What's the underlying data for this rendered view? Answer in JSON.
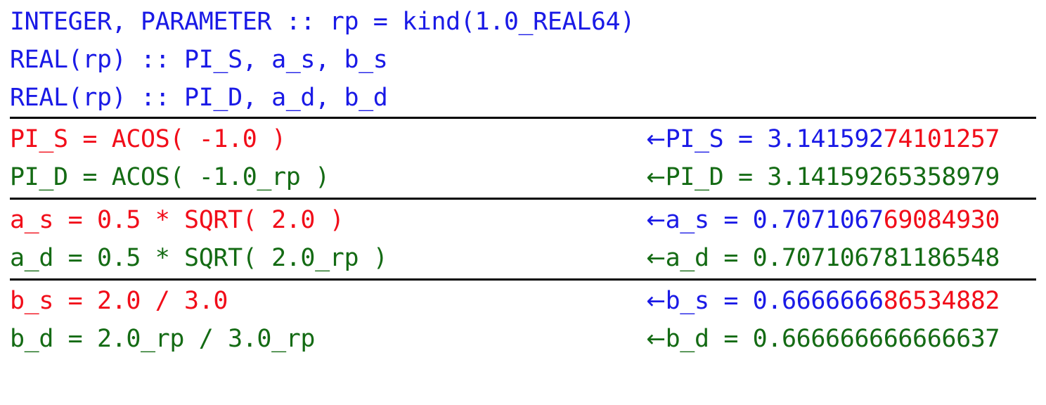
{
  "colors": {
    "single_precision": "#f10d19",
    "double_precision": "#146b14",
    "neutral": "#1a1ae6",
    "rule": "#000000",
    "background": "#ffffff"
  },
  "declarations": [
    {
      "text": "INTEGER, PARAMETER :: rp = kind(1.0_REAL64)",
      "color": "blue"
    },
    {
      "text": "REAL(rp) :: PI_S, a_s, b_s",
      "color": "blue"
    },
    {
      "text": "REAL(rp) :: PI_D, a_d, b_d",
      "color": "blue"
    }
  ],
  "arrow_glyph": "←",
  "groups": [
    {
      "single": {
        "statement": "PI_S = ACOS( -1.0 )",
        "result_label": "PI_S = ",
        "result_exact": "3.141592",
        "result_error": "74101257"
      },
      "double": {
        "statement": "PI_D = ACOS( -1.0_rp )",
        "result_label": "PI_D = ",
        "result_value": "3.14159265358979"
      }
    },
    {
      "single": {
        "statement": "a_s = 0.5 * SQRT( 2.0 )",
        "result_label": "a_s = ",
        "result_exact": "0.7071067",
        "result_error": "69084930"
      },
      "double": {
        "statement": "a_d = 0.5 * SQRT( 2.0_rp )",
        "result_label": "a_d = ",
        "result_value": "0.707106781186548"
      }
    },
    {
      "single": {
        "statement": "b_s = 2.0 / 3.0",
        "result_label": "b_s = ",
        "result_exact": "0.6666666",
        "result_error": "86534882"
      },
      "double": {
        "statement": "b_d = 2.0_rp / 3.0_rp",
        "result_label": "b_d = ",
        "result_value": "0.666666666666637"
      }
    }
  ]
}
